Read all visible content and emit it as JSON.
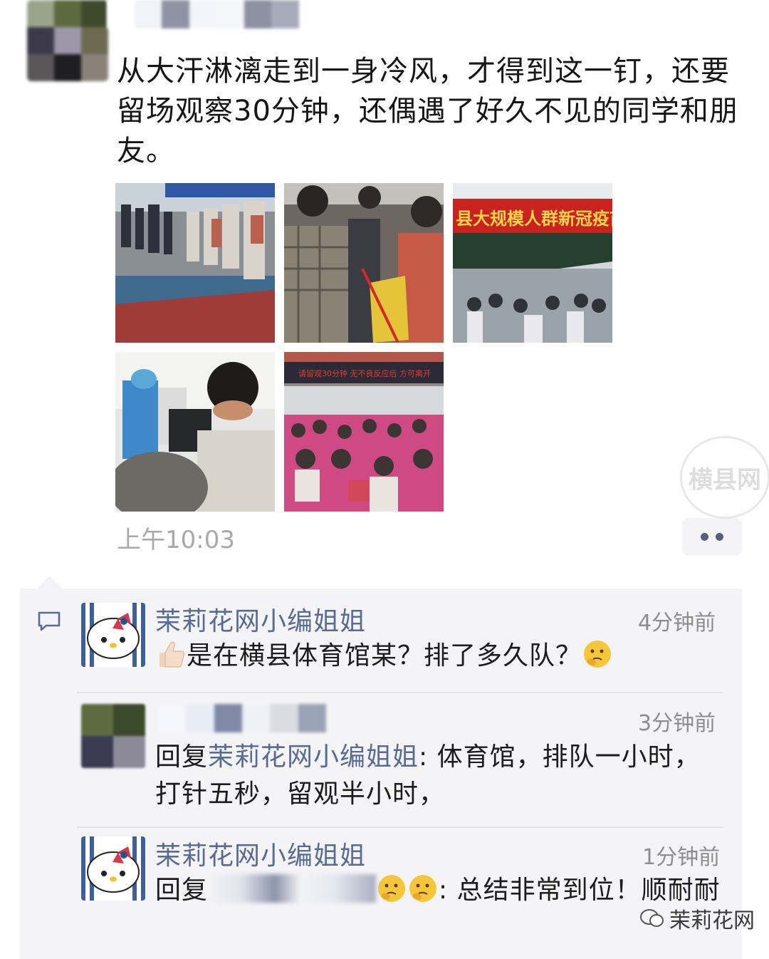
{
  "post": {
    "text": "从大汗淋漓走到一身冷风，才得到这一钉，还要留场观察30分钟，还偶遇了好久不见的同学和朋友。",
    "time": "上午10:03"
  },
  "comments": [
    {
      "author": "茉莉花网小编姐姐",
      "time": "4分钟前",
      "text": "是在横县体育馆某？排了多久队？"
    },
    {
      "time": "3分钟前",
      "reply_prefix": "回复",
      "reply_to": "茉莉花网小编姐姐",
      "text": ": 体育馆，排队一小时，打针五秒，留观半小时，"
    },
    {
      "author": "茉莉花网小编姐姐",
      "time": "1分钟前",
      "reply_prefix": "回复",
      "text": ": 总结非常到位！顺耐耐"
    }
  ],
  "brand": {
    "watermark": "茉莉花网",
    "stamp": "横县网"
  },
  "colors": {
    "link": "#586b94",
    "panel": "#f4f4f6"
  },
  "icons": {
    "comment": "speech-bubble-icon",
    "thumbs_up": "thumbs-up-emoji",
    "thinking": "thinking-face-emoji",
    "more": "more-dots-icon"
  }
}
